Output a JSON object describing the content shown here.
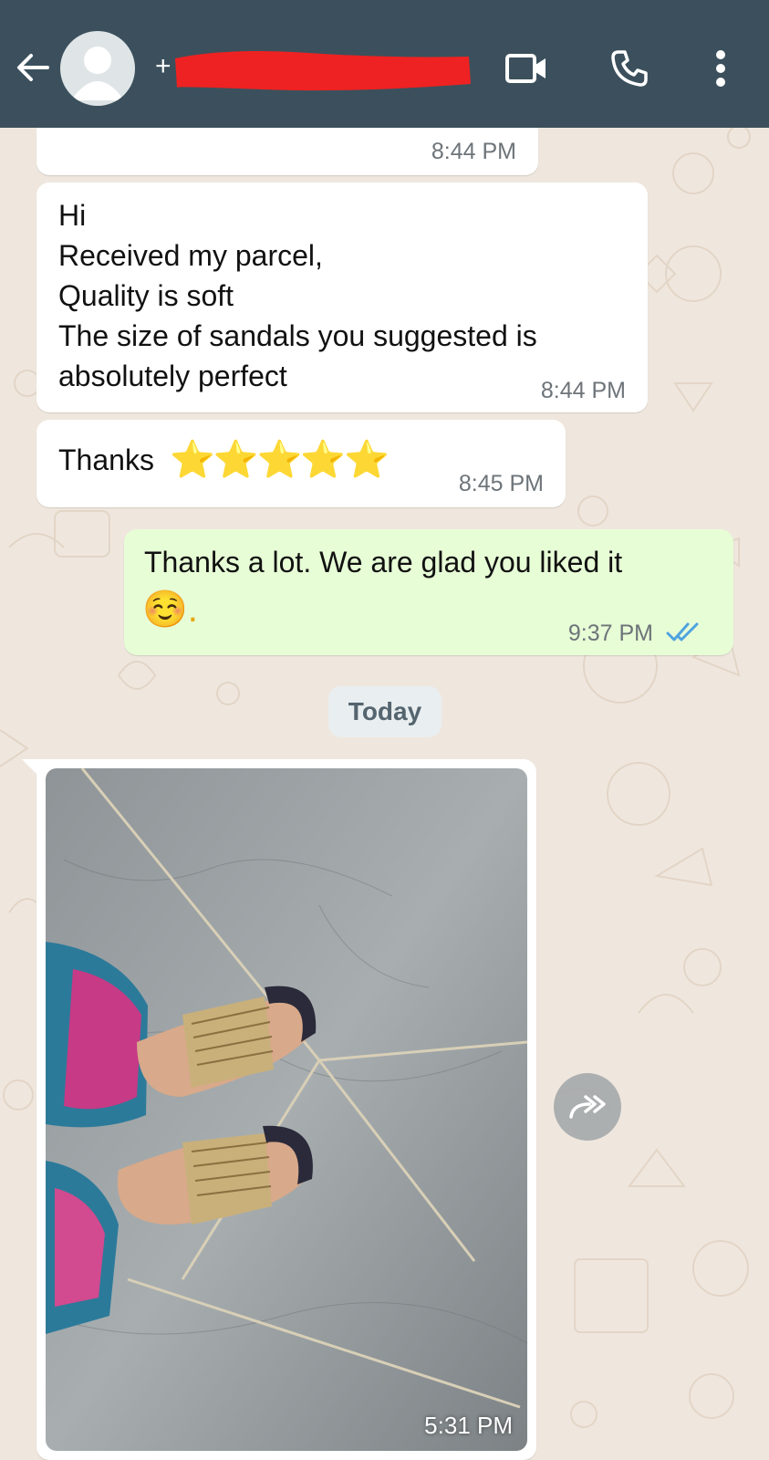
{
  "header": {
    "contact_prefix": "+",
    "icons": [
      "back-arrow-icon",
      "avatar",
      "video-call-icon",
      "voice-call-icon",
      "more-options-icon"
    ]
  },
  "messages": [
    {
      "direction": "incoming",
      "text": "",
      "time": "8:44 PM"
    },
    {
      "direction": "incoming",
      "text": "Hi\nReceived my parcel,\nQuality is soft\nThe size of sandals you suggested is\nabsolutely perfect",
      "time": "8:44 PM"
    },
    {
      "direction": "incoming",
      "text": "Thanks",
      "emoji": "⭐⭐⭐⭐⭐",
      "time": "8:45 PM"
    },
    {
      "direction": "outgoing",
      "text": "Thanks a lot. We are glad you liked it",
      "emoji_line": "☺️.",
      "time": "9:37 PM",
      "status": "read"
    }
  ],
  "date_separator": "Today",
  "image_message": {
    "direction": "incoming",
    "time": "5:31 PM"
  },
  "colors": {
    "header": "#3b505c",
    "chat_bg": "#efe7de",
    "incoming_bubble": "#ffffff",
    "outgoing_bubble": "#e7fdd6",
    "read_ticks": "#4fa3e0",
    "redaction": "#ee2222"
  }
}
